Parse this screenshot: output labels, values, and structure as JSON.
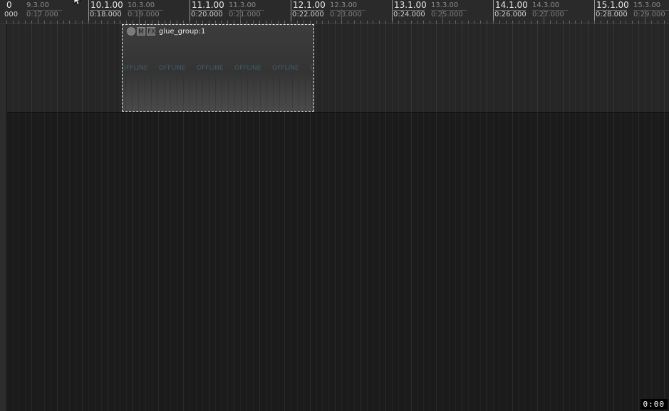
{
  "ruler": {
    "major": [
      {
        "measure": "10.1.00",
        "time": "0:18.000"
      },
      {
        "measure": "11.1.00",
        "time": "0:20.000"
      },
      {
        "measure": "12.1.00",
        "time": "0:22.000"
      },
      {
        "measure": "13.1.00",
        "time": "0:24.000"
      },
      {
        "measure": "14.1.00",
        "time": "0:26.000"
      },
      {
        "measure": "15.1.00",
        "time": "0:28.000"
      }
    ],
    "minor": [
      {
        "measure": "9.3.00",
        "time": "0:17.000"
      },
      {
        "measure": "10.3.00",
        "time": "0:19.000"
      },
      {
        "measure": "11.3.00",
        "time": "0:21.000"
      },
      {
        "measure": "12.3.00",
        "time": "0:23.000"
      },
      {
        "measure": "13.3.00",
        "time": "0:25.000"
      },
      {
        "measure": "14.3.00",
        "time": "0:27.000"
      },
      {
        "measure": "15.3.00",
        "time": "0:29.000"
      }
    ],
    "partial_left": {
      "measure": "0",
      "time": "000"
    }
  },
  "item": {
    "title": "glue_group:1",
    "mute_label": "M",
    "fx_label": "FX",
    "offline_text": "OFFLINE",
    "offline_partial": "O"
  },
  "time_readout": "0:00",
  "colors": {
    "background": "#1a1a1a",
    "ruler": "#2a2a2a",
    "track_lane": "#262626",
    "offline_text": "#3f5a6a"
  }
}
